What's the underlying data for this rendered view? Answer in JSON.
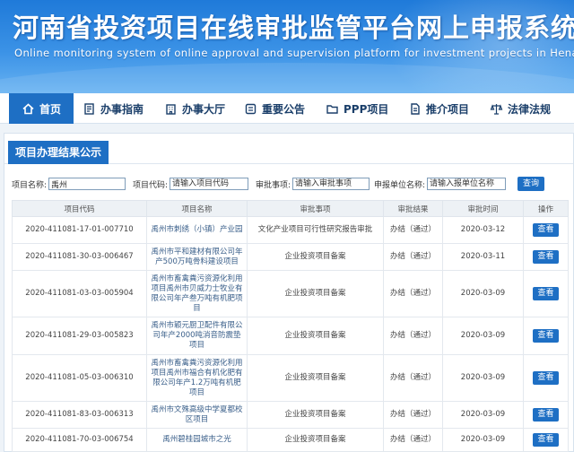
{
  "header": {
    "title": "河南省投资项目在线审批监管平台网上申报系统",
    "subtitle": "Online monitoring system of online approval and supervision platform for investment projects in Henan"
  },
  "nav": [
    {
      "label": "首页",
      "icon": "home-icon"
    },
    {
      "label": "办事指南",
      "icon": "book-icon"
    },
    {
      "label": "办事大厅",
      "icon": "building-icon"
    },
    {
      "label": "重要公告",
      "icon": "notice-icon"
    },
    {
      "label": "PPP项目",
      "icon": "folder-icon"
    },
    {
      "label": "推介项目",
      "icon": "document-icon"
    },
    {
      "label": "法律法规",
      "icon": "scales-icon"
    }
  ],
  "panel": {
    "title": "项目办理结果公示"
  },
  "search": {
    "name_label": "项目名称:",
    "name_value": "禹州",
    "code_label": "项目代码:",
    "code_placeholder": "请输入项目代码",
    "matter_label": "审批事项:",
    "matter_placeholder": "请输入审批事项",
    "unit_label": "申报单位名称:",
    "unit_placeholder": "请输入报单位名称",
    "query_label": "查询"
  },
  "table": {
    "columns": [
      "项目代码",
      "项目名称",
      "审批事项",
      "审批结果",
      "审批时间",
      "操作"
    ],
    "rows": [
      {
        "code": "2020-411081-17-01-007710",
        "name": "禹州市刺绣（小镇）产业园",
        "matter": "文化产业项目可行性研究报告审批",
        "result": "办结（通过）",
        "date": "2020-03-12",
        "action": "查看"
      },
      {
        "code": "2020-411081-30-03-006467",
        "name": "禹州市平和建材有限公司年产500万吨骨料建设项目",
        "matter": "企业投资项目备案",
        "result": "办结（通过）",
        "date": "2020-03-11",
        "action": "查看"
      },
      {
        "code": "2020-411081-03-03-005904",
        "name": "禹州市畜禽粪污资源化利用项目禹州市贝威力士牧业有限公司年产叁万吨有机肥项目",
        "matter": "企业投资项目备案",
        "result": "办结（通过）",
        "date": "2020-03-09",
        "action": "查看"
      },
      {
        "code": "2020-411081-29-03-005823",
        "name": "禹州市颖元厨卫配件有限公司年产2000吨消音防震垫项目",
        "matter": "企业投资项目备案",
        "result": "办结（通过）",
        "date": "2020-03-09",
        "action": "查看"
      },
      {
        "code": "2020-411081-05-03-006310",
        "name": "禹州市畜禽粪污资源化利用项目禹州市福合有机化肥有限公司年产1.2万吨有机肥项目",
        "matter": "企业投资项目备案",
        "result": "办结（通过）",
        "date": "2020-03-09",
        "action": "查看"
      },
      {
        "code": "2020-411081-83-03-006313",
        "name": "禹州市文殊高级中学夏都校区项目",
        "matter": "企业投资项目备案",
        "result": "办结（通过）",
        "date": "2020-03-09",
        "action": "查看"
      },
      {
        "code": "2020-411081-70-03-006754",
        "name": "禹州碧桂园城市之光",
        "matter": "企业投资项目备案",
        "result": "办结（通过）",
        "date": "2020-03-09",
        "action": "查看"
      }
    ]
  }
}
